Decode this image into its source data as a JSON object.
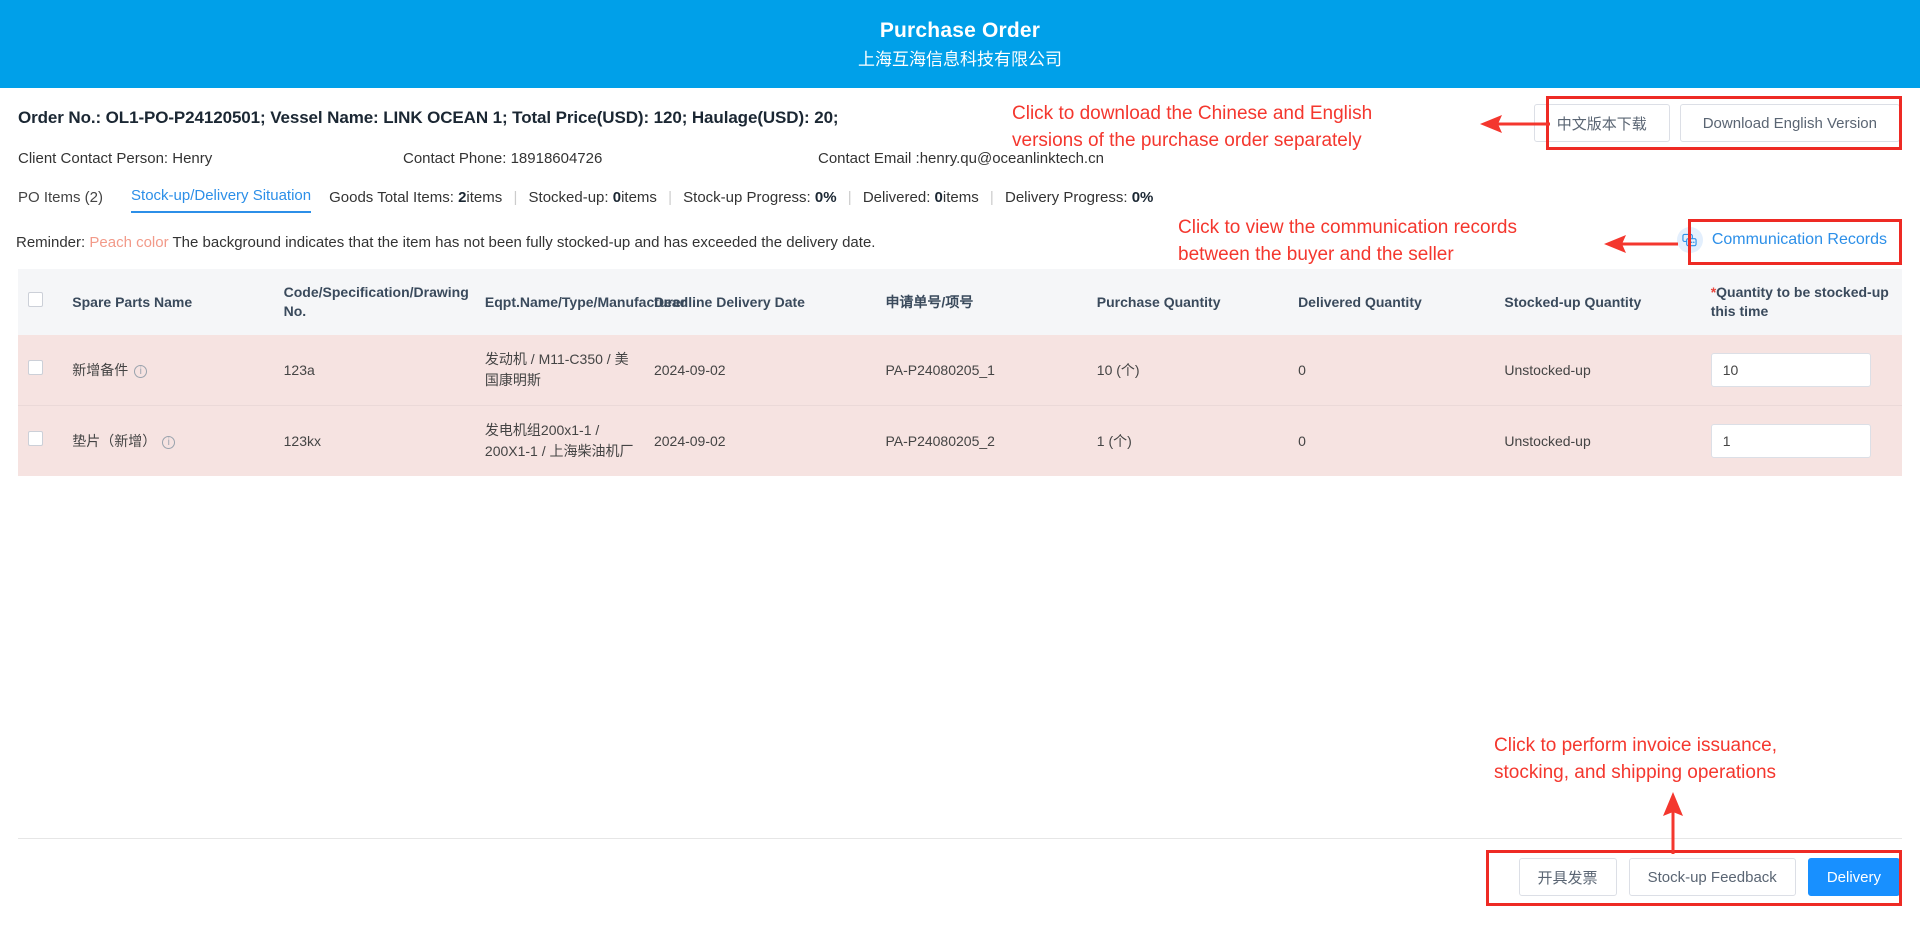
{
  "header": {
    "title": "Purchase Order",
    "subtitle": "上海互海信息科技有限公司",
    "bg_color": "#00a0e9"
  },
  "order_info": {
    "line": "Order No.:  OL1-PO-P24120501; Vessel Name:  LINK OCEAN 1; Total Price(USD):  120; Haulage(USD):  20;",
    "order_no_label": "Order No.:",
    "order_no": "OL1-PO-P24120501",
    "vessel_label": "Vessel Name:",
    "vessel": "LINK OCEAN 1",
    "total_price_label": "Total Price(USD):",
    "total_price": "120",
    "haulage_label": "Haulage(USD):",
    "haulage": "20",
    "client_contact": "Client Contact Person:  Henry",
    "contact_phone": "Contact Phone:  18918604726",
    "contact_email": "Contact Email :henry.qu@oceanlinktech.cn"
  },
  "download": {
    "chinese_label": "中文版本下载",
    "english_label": "Download English Version"
  },
  "tabs": [
    {
      "label": "PO Items (2)",
      "active": false
    },
    {
      "label": "Stock-up/Delivery Situation",
      "active": true
    }
  ],
  "stats": {
    "goods_total_label": "Goods Total Items:",
    "goods_total_value": "2",
    "goods_total_unit": "items",
    "stocked_up_label": "Stocked-up:",
    "stocked_up_value": "0",
    "stocked_up_unit": "items",
    "stockup_progress_label": "Stock-up Progress:",
    "stockup_progress_value": "0",
    "stockup_progress_unit": "%",
    "delivered_label": "Delivered:",
    "delivered_value": "0",
    "delivered_unit": "items",
    "delivery_progress_label": "Delivery Progress:",
    "delivery_progress_value": "0",
    "delivery_progress_unit": "%"
  },
  "reminder": {
    "prefix": "Reminder:",
    "highlight": "Peach color",
    "text": "The background indicates that the item has not been fully stocked-up and has exceeded the delivery date.",
    "highlight_color": "#f29a89"
  },
  "communication": {
    "label": "Communication Records",
    "icon": "chat-bubble-icon",
    "color": "#2c8fe8"
  },
  "table": {
    "columns": [
      "",
      "Spare Parts Name",
      "Code/Specification/Drawing No.",
      "Eqpt.Name/Type/Manufacturer",
      "Deadline Delivery Date",
      "申请单号/项号",
      "Purchase Quantity",
      "Delivered Quantity",
      "Stocked-up Quantity",
      "Quantity to be stocked-up this time"
    ],
    "required_marker": "*",
    "rows": [
      {
        "name": "新增备件",
        "code": "123a",
        "eqpt": "发动机 / M11-C350 / 美国康明斯",
        "deadline": "2024-09-02",
        "appl_no": "PA-P24080205_1",
        "purchase_qty": "10 (个)",
        "delivered_qty": "0",
        "stocked_qty": "Unstocked-up",
        "qty_input": "10"
      },
      {
        "name": "垫片（新增）",
        "code": "123kx",
        "eqpt": "发电机组200x1-1 / 200X1-1 / 上海柴油机厂",
        "deadline": "2024-09-02",
        "appl_no": "PA-P24080205_2",
        "purchase_qty": "1 (个)",
        "delivered_qty": "0",
        "stocked_qty": "Unstocked-up",
        "qty_input": "1"
      }
    ]
  },
  "footer_actions": {
    "invoice_label": "开具发票",
    "stockup_feedback_label": "Stock-up Feedback",
    "delivery_label": "Delivery",
    "primary_color": "#1890ff"
  },
  "annotations": {
    "download_note": "Click to download the Chinese and English\nversions of the purchase order separately",
    "communication_note": "Click to view the communication records\nbetween the buyer and the seller",
    "footer_note": "Click to perform invoice issuance,\nstocking, and shipping operations",
    "color": "#f4372e"
  }
}
